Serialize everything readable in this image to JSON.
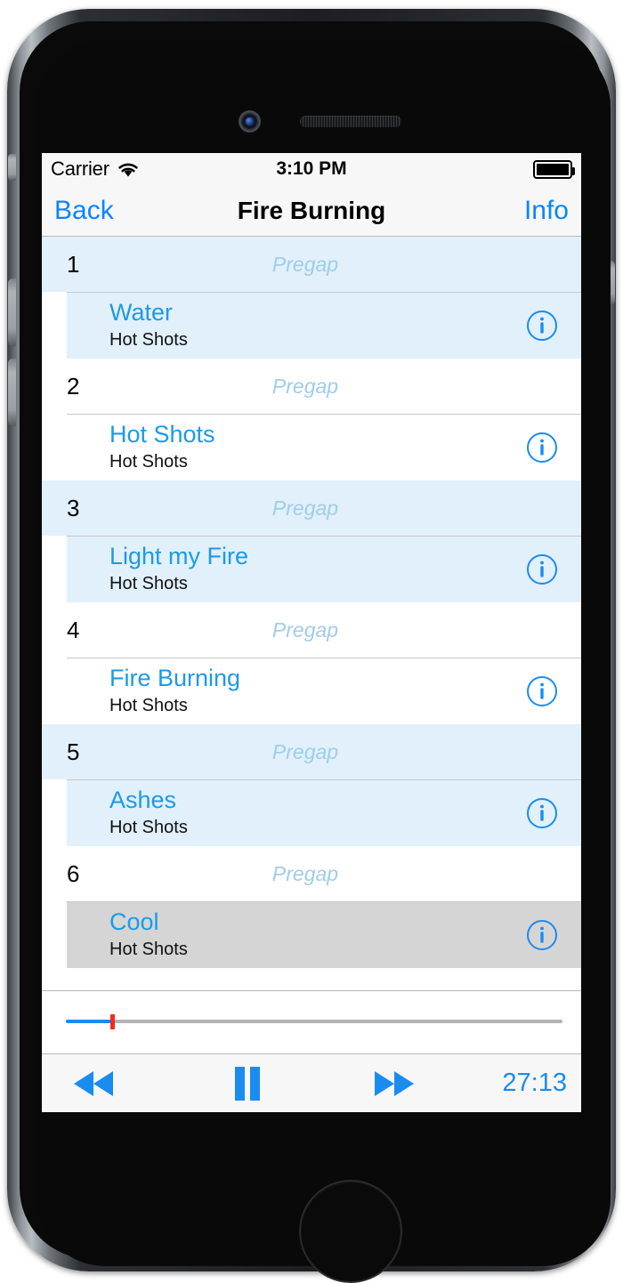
{
  "device": {
    "camera_icon": "front-camera-icon",
    "speaker_icon": "earpiece-speaker-icon",
    "home_button": "home-button"
  },
  "status_bar": {
    "carrier": "Carrier",
    "wifi_icon": "wifi-icon",
    "time": "3:10 PM",
    "battery_icon": "battery-full-icon"
  },
  "nav_bar": {
    "back_label": "Back",
    "title": "Fire Burning",
    "info_label": "Info"
  },
  "colors": {
    "tint_blue": "#0a84ff",
    "song_blue": "#1c9ae8",
    "row_shaded": "#e1f0fb",
    "row_selected": "#d5d5d5",
    "pregap_text": "#9fcdea",
    "playhead_red": "#f42a18",
    "slider_fill": "#1a8cf0"
  },
  "track_list": {
    "pregap_label": "Pregap",
    "info_icon": "info-circle-icon",
    "tracks": [
      {
        "number": "1",
        "pregap": "Pregap",
        "title": "Water",
        "artist": "Hot Shots",
        "shaded": true,
        "selected": false
      },
      {
        "number": "2",
        "pregap": "Pregap",
        "title": "Hot Shots",
        "artist": "Hot Shots",
        "shaded": false,
        "selected": false
      },
      {
        "number": "3",
        "pregap": "Pregap",
        "title": "Light my Fire",
        "artist": "Hot Shots",
        "shaded": true,
        "selected": false
      },
      {
        "number": "4",
        "pregap": "Pregap",
        "title": "Fire Burning",
        "artist": "Hot Shots",
        "shaded": false,
        "selected": false
      },
      {
        "number": "5",
        "pregap": "Pregap",
        "title": "Ashes",
        "artist": "Hot Shots",
        "shaded": true,
        "selected": false
      },
      {
        "number": "6",
        "pregap": "Pregap",
        "title": "Cool",
        "artist": "Hot Shots",
        "shaded": false,
        "selected": true
      }
    ]
  },
  "player": {
    "slider": {
      "buffered_percent": 9.3,
      "playhead_percent": 9.3
    },
    "rewind_icon": "rewind-icon",
    "playpause_icon": "pause-icon",
    "forward_icon": "fast-forward-icon",
    "elapsed_time": "27:13"
  }
}
